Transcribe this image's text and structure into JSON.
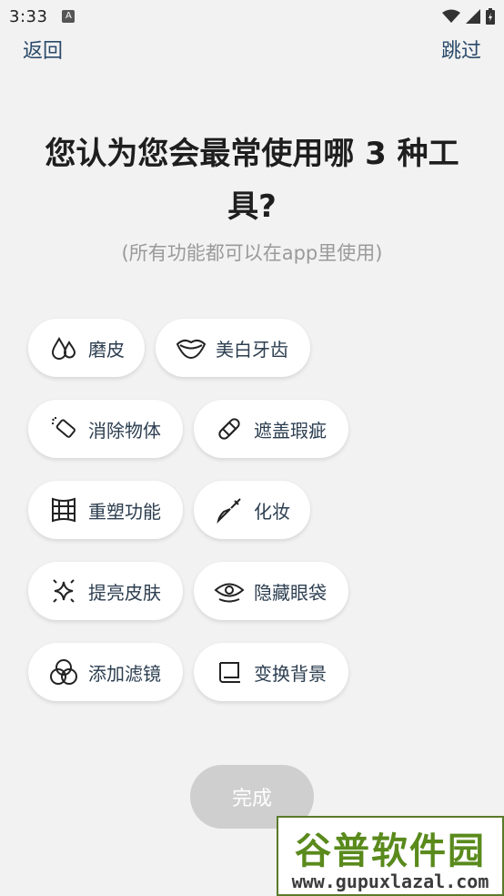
{
  "status": {
    "time": "3:33",
    "notification": "A"
  },
  "nav": {
    "back": "返回",
    "skip": "跳过"
  },
  "question": {
    "title": "您认为您会最常使用哪 3 种工具?",
    "subtitle": "(所有功能都可以在app里使用)"
  },
  "tools": [
    {
      "label": "磨皮",
      "icon": "drops-icon"
    },
    {
      "label": "美白牙齿",
      "icon": "lips-icon"
    },
    {
      "label": "消除物体",
      "icon": "eraser-icon"
    },
    {
      "label": "遮盖瑕疵",
      "icon": "bandage-icon"
    },
    {
      "label": "重塑功能",
      "icon": "grid-icon"
    },
    {
      "label": "化妆",
      "icon": "brush-icon"
    },
    {
      "label": "提亮皮肤",
      "icon": "sparkle-icon"
    },
    {
      "label": "隐藏眼袋",
      "icon": "eye-icon"
    },
    {
      "label": "添加滤镜",
      "icon": "circles-icon"
    },
    {
      "label": "变换背景",
      "icon": "background-icon"
    }
  ],
  "done_button": "完成",
  "watermark": {
    "brand": "谷普软件园",
    "url": "www.gupuxlazal.com"
  },
  "colors": {
    "background": "#f2f2f2",
    "chip": "#ffffff",
    "text": "#2c3e50",
    "button_disabled": "#cfcfcf",
    "watermark_green": "#5a8a1c"
  }
}
